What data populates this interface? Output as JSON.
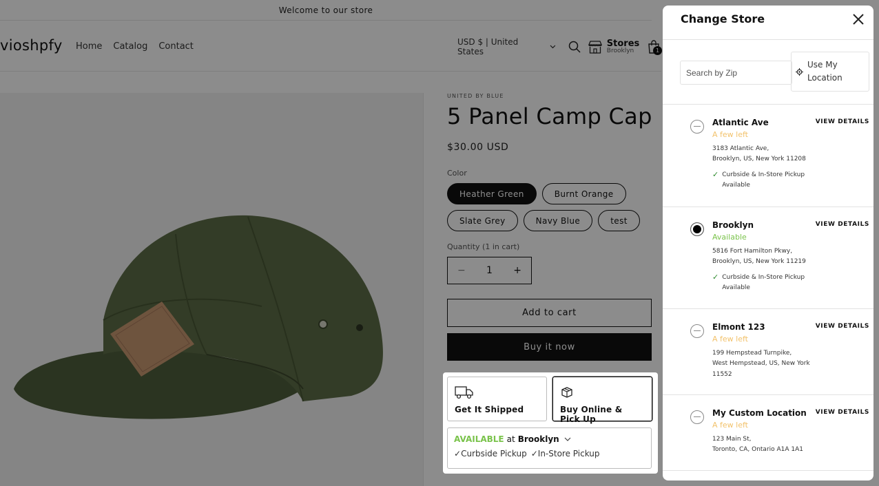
{
  "announcement": "Welcome to our store",
  "header": {
    "logo": "vioshpfy",
    "nav": [
      "Home",
      "Catalog",
      "Contact"
    ],
    "currency": "USD $ | United States",
    "stores_label": "Stores",
    "stores_sub": "Brooklyn",
    "cart_count": "1"
  },
  "product": {
    "vendor": "UNITED BY BLUE",
    "title": "5 Panel Camp Cap",
    "price": "$30.00 USD",
    "color_label": "Color",
    "colors": [
      "Heather Green",
      "Burnt Orange",
      "Slate Grey",
      "Navy Blue",
      "test"
    ],
    "selected_color": "Heather Green",
    "quantity_label": "Quantity (1 in cart)",
    "quantity": "1",
    "minus": "−",
    "plus": "+",
    "add_to_cart": "Add to cart",
    "buy_now": "Buy it now"
  },
  "pickup": {
    "ship_label": "Get It Shipped",
    "pickup_label": "Buy Online & Pick Up",
    "available_word": "AVAILABLE",
    "at_word": "at",
    "store": "Brooklyn",
    "options": [
      "Curbside Pickup",
      "In-Store Pickup"
    ]
  },
  "drawer": {
    "title": "Change Store",
    "zip_placeholder": "Search by Zip",
    "use_location": "Use My Location",
    "view_details": "VIEW DETAILS",
    "stores": [
      {
        "name": "Atlantic Ave",
        "status": "A few left",
        "status_type": "few",
        "address": [
          "3183 Atlantic Ave,",
          "Brooklyn, US, New York 11208"
        ],
        "pickup": "Curbside & In-Store Pickup Available",
        "selected": false
      },
      {
        "name": "Brooklyn",
        "status": "Available",
        "status_type": "available",
        "address": [
          "5816 Fort Hamilton Pkwy,",
          "Brooklyn, US, New York 11219"
        ],
        "pickup": "Curbside & In-Store Pickup Available",
        "selected": true
      },
      {
        "name": "Elmont 123",
        "status": "A few left",
        "status_type": "few",
        "address": [
          "199 Hempstead Turnpike,",
          "West Hempstead, US, New York 11552"
        ],
        "pickup": "",
        "selected": false
      },
      {
        "name": "My Custom Location",
        "status": "A few left",
        "status_type": "few",
        "address": [
          "123 Main St,",
          "Toronto, CA, Ontario A1A 1A1"
        ],
        "pickup": "",
        "selected": false
      }
    ]
  },
  "colors": {
    "available": "#7ac34b",
    "few_left": "#f2c26b",
    "check": "#2e8b2e",
    "cap": "#5a6b44"
  }
}
